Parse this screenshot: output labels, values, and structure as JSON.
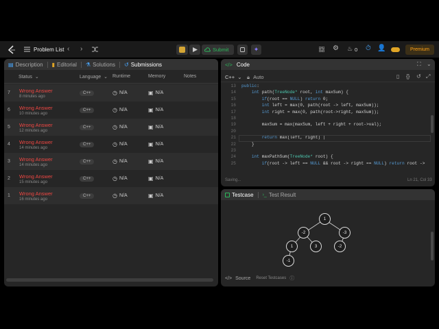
{
  "topbar": {
    "problem_list": "Problem List",
    "submit": "Submit",
    "streak": "0",
    "premium": "Premium"
  },
  "left": {
    "tabs": [
      {
        "label": "Description"
      },
      {
        "label": "Editorial"
      },
      {
        "label": "Solutions"
      },
      {
        "label": "Submissions"
      }
    ],
    "headers": {
      "status": "Status",
      "language": "Language",
      "runtime": "Runtime",
      "memory": "Memory",
      "notes": "Notes"
    },
    "rows": [
      {
        "num": "7",
        "status": "Wrong Answer",
        "ago": "8 minutes ago",
        "lang": "C++",
        "runtime": "N/A",
        "memory": "N/A"
      },
      {
        "num": "6",
        "status": "Wrong Answer",
        "ago": "10 minutes ago",
        "lang": "C++",
        "runtime": "N/A",
        "memory": "N/A"
      },
      {
        "num": "5",
        "status": "Wrong Answer",
        "ago": "12 minutes ago",
        "lang": "C++",
        "runtime": "N/A",
        "memory": "N/A"
      },
      {
        "num": "4",
        "status": "Wrong Answer",
        "ago": "14 minutes ago",
        "lang": "C++",
        "runtime": "N/A",
        "memory": "N/A"
      },
      {
        "num": "3",
        "status": "Wrong Answer",
        "ago": "14 minutes ago",
        "lang": "C++",
        "runtime": "N/A",
        "memory": "N/A"
      },
      {
        "num": "2",
        "status": "Wrong Answer",
        "ago": "15 minutes ago",
        "lang": "C++",
        "runtime": "N/A",
        "memory": "N/A"
      },
      {
        "num": "1",
        "status": "Wrong Answer",
        "ago": "16 minutes ago",
        "lang": "C++",
        "runtime": "N/A",
        "memory": "N/A"
      }
    ]
  },
  "code": {
    "title": "Code",
    "language": "C++",
    "auto": "Auto",
    "status": "Saving...",
    "cursor": "Ln 21, Col 33",
    "lines": [
      {
        "n": "13",
        "parts": [
          [
            "kw",
            "public"
          ],
          [
            "t",
            ":"
          ]
        ]
      },
      {
        "n": "14",
        "parts": [
          [
            "t",
            "    "
          ],
          [
            "kw",
            "int"
          ],
          [
            "t",
            " path("
          ],
          [
            "ty",
            "TreeNode*"
          ],
          [
            "t",
            " root, "
          ],
          [
            "kw",
            "int"
          ],
          [
            "t",
            " maxSum) {"
          ]
        ]
      },
      {
        "n": "15",
        "parts": [
          [
            "t",
            "        "
          ],
          [
            "kw",
            "if"
          ],
          [
            "t",
            "(root == "
          ],
          [
            "kw",
            "NULL"
          ],
          [
            "t",
            ") "
          ],
          [
            "kw",
            "return"
          ],
          [
            "t",
            " 0;"
          ]
        ]
      },
      {
        "n": "16",
        "parts": [
          [
            "t",
            "        "
          ],
          [
            "kw",
            "int"
          ],
          [
            "t",
            " left = max(0, path(root -> left, maxSum));"
          ]
        ]
      },
      {
        "n": "17",
        "parts": [
          [
            "t",
            "        "
          ],
          [
            "kw",
            "int"
          ],
          [
            "t",
            " right = max(0, path(root->right, maxSum));"
          ]
        ]
      },
      {
        "n": "18",
        "parts": [
          [
            "t",
            ""
          ]
        ]
      },
      {
        "n": "19",
        "parts": [
          [
            "t",
            "        maxSum = max(maxSum, left + right + root->val);"
          ]
        ]
      },
      {
        "n": "20",
        "parts": [
          [
            "t",
            ""
          ]
        ]
      },
      {
        "n": "21",
        "parts": [
          [
            "t",
            "        "
          ],
          [
            "kw",
            "return"
          ],
          [
            "t",
            " max(left, right) |"
          ]
        ]
      },
      {
        "n": "22",
        "parts": [
          [
            "t",
            "    }"
          ]
        ]
      },
      {
        "n": "23",
        "parts": [
          [
            "t",
            ""
          ]
        ]
      },
      {
        "n": "24",
        "parts": [
          [
            "t",
            "    "
          ],
          [
            "kw",
            "int"
          ],
          [
            "t",
            " maxPathSum("
          ],
          [
            "ty",
            "TreeNode*"
          ],
          [
            "t",
            " root) {"
          ]
        ]
      },
      {
        "n": "25",
        "parts": [
          [
            "t",
            "        "
          ],
          [
            "kw",
            "if"
          ],
          [
            "t",
            "(root -> left == "
          ],
          [
            "kw",
            "NULL"
          ],
          [
            "t",
            " && root -> right == "
          ],
          [
            "kw",
            "NULL"
          ],
          [
            "t",
            ") "
          ],
          [
            "kw",
            "return"
          ],
          [
            "t",
            " root ->"
          ]
        ]
      }
    ]
  },
  "test": {
    "tab_testcase": "Testcase",
    "tab_result": "Test Result",
    "source": "Source",
    "reset": "Reset Testcases",
    "nodes": [
      "1",
      "-2",
      "-3",
      "1",
      "3",
      "-2",
      "-1"
    ]
  }
}
